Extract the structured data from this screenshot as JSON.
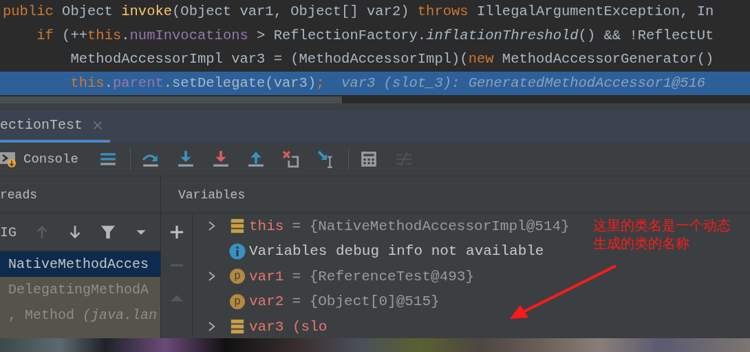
{
  "editor": {
    "lines": [
      {
        "selected": false,
        "tokens": [
          {
            "kind": "keyword",
            "text": "public"
          },
          {
            "kind": "plain",
            "text": " Object "
          },
          {
            "kind": "method",
            "text": "invoke"
          },
          {
            "kind": "plain",
            "text": "(Object var1, Object[] var2) "
          },
          {
            "kind": "keyword",
            "text": "throws"
          },
          {
            "kind": "plain",
            "text": " IllegalArgumentException, In"
          }
        ]
      },
      {
        "selected": false,
        "tokens": [
          {
            "kind": "keyword",
            "text": "    if"
          },
          {
            "kind": "plain",
            "text": " (++"
          },
          {
            "kind": "keyword",
            "text": "this"
          },
          {
            "kind": "plain",
            "text": "."
          },
          {
            "kind": "field",
            "text": "numInvocations"
          },
          {
            "kind": "plain",
            "text": " > ReflectionFactory."
          },
          {
            "kind": "static",
            "text": "inflationThreshold"
          },
          {
            "kind": "plain",
            "text": "() && !ReflectUt"
          }
        ]
      },
      {
        "selected": false,
        "tokens": [
          {
            "kind": "plain",
            "text": "        MethodAccessorImpl var3 = (MethodAccessorImpl)("
          },
          {
            "kind": "keyword",
            "text": "new"
          },
          {
            "kind": "plain",
            "text": " MethodAccessorGenerator()"
          }
        ]
      },
      {
        "selected": true,
        "tokens": [
          {
            "kind": "keyword",
            "text": "        this"
          },
          {
            "kind": "plain",
            "text": "."
          },
          {
            "kind": "field",
            "text": "parent"
          },
          {
            "kind": "plain",
            "text": ".setDelegate(var3)"
          },
          {
            "kind": "keyword",
            "text": ";"
          },
          {
            "kind": "hint",
            "text": "  var3 (slot_3): GeneratedMethodAccessor1@516"
          }
        ]
      }
    ]
  },
  "debug_tab": {
    "label": "ectionTest",
    "selected": true
  },
  "toolbar": {
    "console_label": "Console",
    "tools": [
      {
        "kind": "layout"
      },
      {
        "kind": "separator"
      },
      {
        "kind": "step-over"
      },
      {
        "kind": "step-into"
      },
      {
        "kind": "force-step-into"
      },
      {
        "kind": "step-out"
      },
      {
        "kind": "drop-frame"
      },
      {
        "kind": "run-to-cursor"
      },
      {
        "kind": "separator"
      },
      {
        "kind": "evaluate"
      },
      {
        "kind": "trace",
        "disabled": true
      }
    ]
  },
  "threads_header": "reads",
  "variables_header": "Variables",
  "threads": {
    "thread": "IG",
    "nav": [
      {
        "kind": "up",
        "disabled": true
      },
      {
        "kind": "down",
        "disabled": false
      },
      {
        "kind": "filter",
        "disabled": false
      },
      {
        "kind": "dropdown",
        "disabled": false
      }
    ],
    "frames": [
      {
        "text": "NativeMethodAcces",
        "selected": true
      },
      {
        "text": "DelegatingMethodA",
        "selected": false
      },
      {
        "text": ", Method *(java.lan*",
        "selected": false
      }
    ]
  },
  "side_tools": [
    {
      "kind": "add",
      "disabled": false
    },
    {
      "kind": "remove",
      "disabled": true
    },
    {
      "kind": "up",
      "disabled": true
    }
  ],
  "variables": [
    {
      "kind": "field",
      "expandable": true,
      "name": "this",
      "value": "= {NativeMethodAccessorImpl@514}"
    },
    {
      "kind": "info",
      "expandable": false,
      "text": "Variables debug info not available"
    },
    {
      "kind": "param",
      "expandable": true,
      "badge": "p",
      "name": "var1",
      "value": "= {ReferenceTest@493}"
    },
    {
      "kind": "param",
      "expandable": false,
      "badge": "p",
      "name": "var2",
      "value": "= {Object[0]@515}"
    },
    {
      "kind": "field",
      "expandable": true,
      "name": "var3 (slo"
    }
  ],
  "annotation": {
    "text": "这里的类名是一个动态生成的类的名称"
  }
}
